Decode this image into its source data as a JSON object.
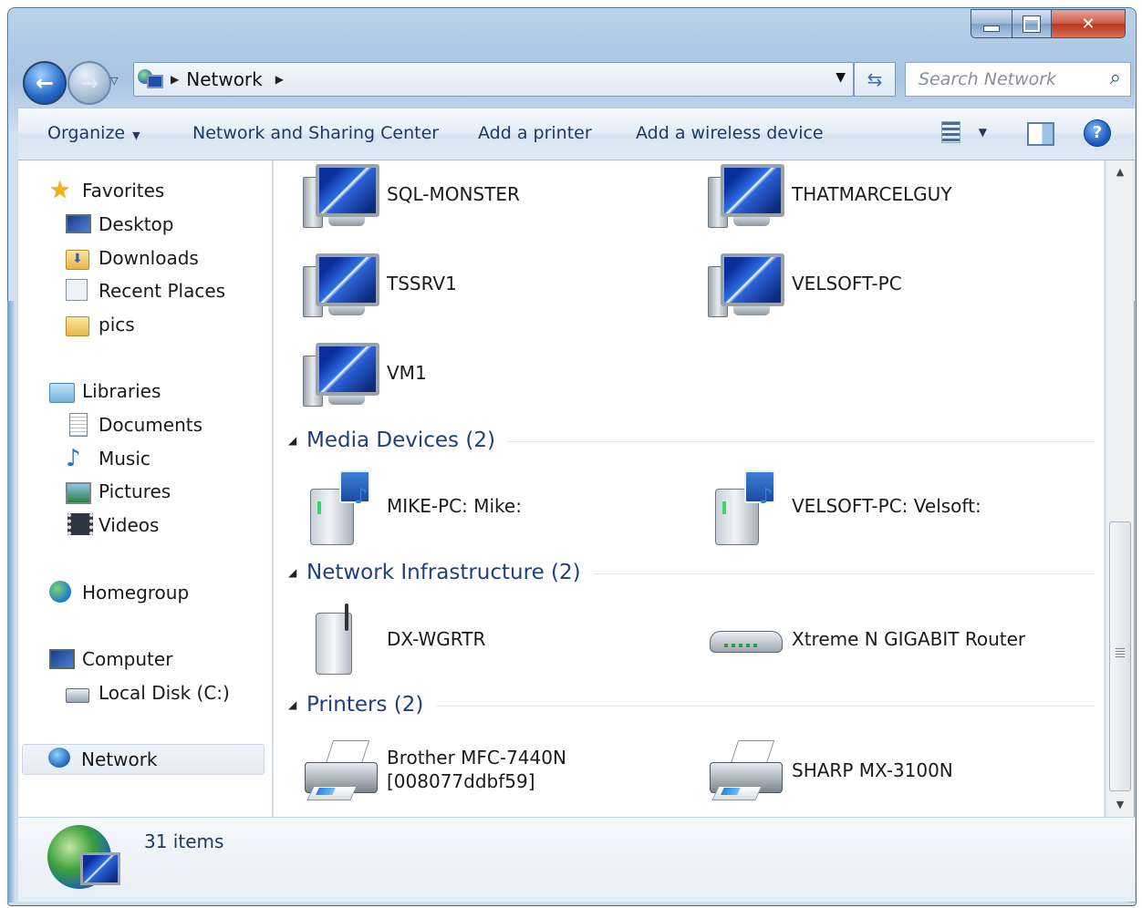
{
  "address_bar": {
    "crumb": "Network"
  },
  "search": {
    "placeholder": "Search Network"
  },
  "command_bar": {
    "organize": "Organize",
    "network_sharing_center": "Network and Sharing Center",
    "add_printer": "Add a printer",
    "add_wireless_device": "Add a wireless device"
  },
  "nav_pane": {
    "favorites": "Favorites",
    "desktop": "Desktop",
    "downloads": "Downloads",
    "recent_places": "Recent Places",
    "pics": "pics",
    "libraries": "Libraries",
    "documents": "Documents",
    "music": "Music",
    "pictures": "Pictures",
    "videos": "Videos",
    "homegroup": "Homegroup",
    "computer": "Computer",
    "local_disk": "Local Disk (C:)",
    "network": "Network"
  },
  "content": {
    "computers": [
      "SQL-MONSTER",
      "THATMARCELGUY",
      "TSSRV1",
      "VELSOFT-PC",
      "VM1"
    ],
    "media_devices": {
      "title": "Media Devices (2)",
      "items": [
        "MIKE-PC: Mike:",
        "VELSOFT-PC: Velsoft:"
      ]
    },
    "network_infrastructure": {
      "title": "Network Infrastructure (2)",
      "items": [
        "DX-WGRTR",
        "Xtreme N GIGABIT Router"
      ]
    },
    "printers": {
      "title": "Printers (2)",
      "items": [
        {
          "line1": "Brother MFC-7440N",
          "line2": "[008077ddbf59]"
        },
        {
          "line1": "SHARP MX-3100N"
        }
      ]
    }
  },
  "details": {
    "count": "31 items"
  }
}
